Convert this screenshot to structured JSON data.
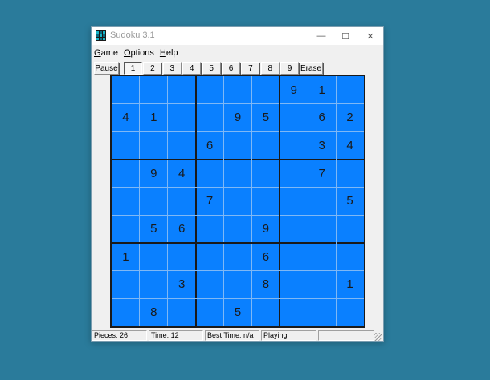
{
  "window": {
    "title": "Sudoku 3.1"
  },
  "window_controls": {
    "minimize": "—",
    "maximize": "☐",
    "close": "✕"
  },
  "menu": [
    {
      "key": "G",
      "rest": "ame"
    },
    {
      "key": "O",
      "rest": "ptions"
    },
    {
      "key": "H",
      "rest": "elp"
    }
  ],
  "toolbar": {
    "pause": "Pause",
    "numbers": [
      "1",
      "2",
      "3",
      "4",
      "5",
      "6",
      "7",
      "8",
      "9"
    ],
    "erase": "Erase",
    "selected_number": "1"
  },
  "board": {
    "colors": {
      "cell": "#0a80ff",
      "thin_line": "#7fb8f5",
      "box_line": "#1a1a1a",
      "digit": "#1a1a1a"
    },
    "grid": [
      [
        "",
        "",
        "",
        "",
        "",
        "",
        "9",
        "1",
        ""
      ],
      [
        "4",
        "1",
        "",
        "",
        "9",
        "5",
        "",
        "6",
        "2"
      ],
      [
        "",
        "",
        "",
        "6",
        "",
        "",
        "",
        "3",
        "4"
      ],
      [
        "",
        "9",
        "4",
        "",
        "",
        "",
        "",
        "7",
        ""
      ],
      [
        "",
        "",
        "",
        "7",
        "",
        "",
        "",
        "",
        "5"
      ],
      [
        "",
        "5",
        "6",
        "",
        "",
        "9",
        "",
        "",
        ""
      ],
      [
        "1",
        "",
        "",
        "",
        "",
        "6",
        "",
        "",
        ""
      ],
      [
        "",
        "",
        "3",
        "",
        "",
        "8",
        "",
        "",
        "1"
      ],
      [
        "",
        "8",
        "",
        "",
        "5",
        "",
        "",
        "",
        ""
      ]
    ]
  },
  "status": {
    "pieces": "Pieces: 26",
    "time": "Time: 12",
    "best_time": "Best Time: n/a",
    "state": "Playing",
    "empty": ""
  }
}
